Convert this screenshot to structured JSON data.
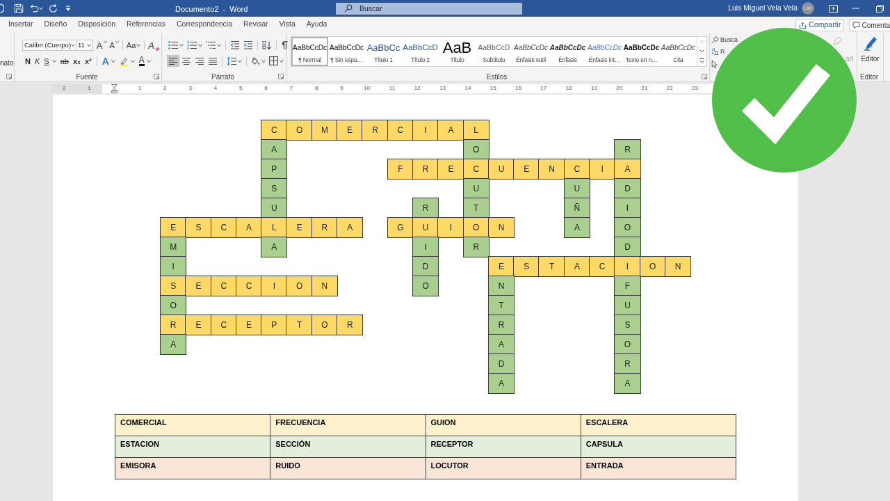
{
  "title_bar": {
    "title": "Documento2  -  Word",
    "search": {
      "placeholder": "Buscar"
    },
    "user": {
      "name": "Luis Miguel Vela Vela",
      "initials": "LM"
    }
  },
  "tabs": [
    {
      "label": "Insertar",
      "selected": false
    },
    {
      "label": "Diseño",
      "selected": false
    },
    {
      "label": "Disposición",
      "selected": false
    },
    {
      "label": "Referencias",
      "selected": false
    },
    {
      "label": "Correspondencia",
      "selected": false
    },
    {
      "label": "Revisar",
      "selected": false
    },
    {
      "label": "Vista",
      "selected": false
    },
    {
      "label": "Ayuda",
      "selected": false
    }
  ],
  "tab_actions": [
    {
      "kind": "share",
      "label": "Compartir"
    },
    {
      "kind": "comment",
      "label": "Comenta"
    }
  ],
  "ribbon": {
    "clipboard": {
      "partial_label": "nato"
    },
    "font": {
      "label": "Fuente",
      "family": "Calibri (Cuerpo)",
      "size": "11",
      "top_tools": [
        {
          "kind": "grow",
          "glyph": "A"
        },
        {
          "kind": "shrink",
          "glyph": "A"
        },
        {
          "kind": "case",
          "glyph": "Aa"
        },
        {
          "kind": "clear",
          "glyph": "A"
        }
      ],
      "bottom_tools": [
        {
          "kind": "bold",
          "glyph": "N"
        },
        {
          "kind": "italic",
          "glyph": "K"
        },
        {
          "kind": "underline",
          "glyph": "S"
        },
        {
          "kind": "strikethrough",
          "glyph": "ab"
        },
        {
          "kind": "subscript",
          "glyph": "x₂"
        },
        {
          "kind": "superscript",
          "glyph": "x²"
        },
        {
          "kind": "text_effects",
          "glyph": "A"
        },
        {
          "kind": "highlight"
        },
        {
          "kind": "font_color",
          "glyph": "A"
        }
      ]
    },
    "paragraph": {
      "label": "Párrafo",
      "alignments": [
        {
          "kind": "left",
          "selected": true
        },
        {
          "kind": "center",
          "selected": false
        },
        {
          "kind": "right",
          "selected": false
        },
        {
          "kind": "justify",
          "selected": false
        }
      ]
    },
    "styles": {
      "label": "Estilos",
      "items": [
        {
          "kind": "normal",
          "preview": "AaBbCcDc",
          "label": "¶ Normal",
          "selected": true
        },
        {
          "kind": "no_spacing",
          "preview": "AaBbCcDc",
          "label": "¶ Sin espa…",
          "selected": false
        },
        {
          "kind": "heading_1",
          "preview": "AaBbCc",
          "label": "Título 1",
          "selected": false
        },
        {
          "kind": "heading_2",
          "preview": "AaBbCcD",
          "label": "Título 2",
          "selected": false
        },
        {
          "kind": "title",
          "preview": "AaB",
          "label": "Título",
          "selected": false
        },
        {
          "kind": "subtitle",
          "preview": "AaBbCcD",
          "label": "Subtítulo",
          "selected": false
        },
        {
          "kind": "subtle_emphasis",
          "preview": "AaBbCcDc",
          "label": "Énfasis sutil",
          "selected": false
        },
        {
          "kind": "emphasis",
          "preview": "AaBbCcDc",
          "label": "Énfasis",
          "selected": false
        },
        {
          "kind": "intense_emphasis",
          "preview": "AaBbCcDc",
          "label": "Énfasis int…",
          "selected": false
        },
        {
          "kind": "strong",
          "preview": "AaBbCcDc",
          "label": "Texto en n…",
          "selected": false
        },
        {
          "kind": "quote",
          "preview": "AaBbCcDc",
          "label": "Cita",
          "selected": false
        }
      ]
    },
    "editing": {
      "tools": [
        {
          "kind": "find",
          "label": "Busca"
        },
        {
          "kind": "replace",
          "label": "R"
        },
        {
          "kind": "select"
        }
      ],
      "partial_label": "ad"
    },
    "editor": {
      "button": "Editor",
      "label": "Editor"
    }
  },
  "ruler": {
    "left_labels": [
      "2",
      "1"
    ],
    "labels": [
      "1",
      "2",
      "3",
      "4",
      "5",
      "6",
      "7",
      "8",
      "9",
      "10",
      "11",
      "12",
      "13",
      "14",
      "15",
      "16",
      "17",
      "18",
      "19",
      "20",
      "21",
      "22",
      "23"
    ]
  },
  "crossword": {
    "rows": [
      [
        null,
        null,
        null,
        null,
        {
          "letter": "C",
          "color": "#ffd966"
        },
        {
          "letter": "O",
          "color": "#ffd966"
        },
        {
          "letter": "M",
          "color": "#ffd966"
        },
        {
          "letter": "E",
          "color": "#ffd966"
        },
        {
          "letter": "R",
          "color": "#ffd966"
        },
        {
          "letter": "C",
          "color": "#ffd966"
        },
        {
          "letter": "I",
          "color": "#ffd966"
        },
        {
          "letter": "A",
          "color": "#ffd966"
        },
        {
          "letter": "L",
          "color": "#ffd966"
        }
      ],
      [
        null,
        null,
        null,
        null,
        {
          "letter": "A",
          "color": "#a9d08e"
        },
        null,
        null,
        null,
        null,
        null,
        null,
        null,
        {
          "letter": "O",
          "color": "#a9d08e"
        },
        null,
        null,
        null,
        null,
        null,
        {
          "letter": "R",
          "color": "#a9d08e"
        }
      ],
      [
        null,
        null,
        null,
        null,
        {
          "letter": "P",
          "color": "#a9d08e"
        },
        null,
        null,
        null,
        null,
        {
          "letter": "F",
          "color": "#ffd966"
        },
        {
          "letter": "R",
          "color": "#ffd966"
        },
        {
          "letter": "E",
          "color": "#ffd966"
        },
        {
          "letter": "C",
          "color": "#ffd966"
        },
        {
          "letter": "U",
          "color": "#ffd966"
        },
        {
          "letter": "E",
          "color": "#ffd966"
        },
        {
          "letter": "N",
          "color": "#ffd966"
        },
        {
          "letter": "C",
          "color": "#ffd966"
        },
        {
          "letter": "I",
          "color": "#ffd966"
        },
        {
          "letter": "A",
          "color": "#ffd966"
        }
      ],
      [
        null,
        null,
        null,
        null,
        {
          "letter": "S",
          "color": "#a9d08e"
        },
        null,
        null,
        null,
        null,
        null,
        null,
        null,
        {
          "letter": "U",
          "color": "#a9d08e"
        },
        null,
        null,
        null,
        {
          "letter": "U",
          "color": "#a9d08e"
        },
        null,
        {
          "letter": "D",
          "color": "#a9d08e"
        }
      ],
      [
        null,
        null,
        null,
        null,
        {
          "letter": "U",
          "color": "#a9d08e"
        },
        null,
        null,
        null,
        null,
        null,
        {
          "letter": "R",
          "color": "#a9d08e"
        },
        null,
        {
          "letter": "T",
          "color": "#a9d08e"
        },
        null,
        null,
        null,
        {
          "letter": "Ñ",
          "color": "#a9d08e"
        },
        null,
        {
          "letter": "I",
          "color": "#a9d08e"
        }
      ],
      [
        {
          "letter": "E",
          "color": "#ffd966"
        },
        {
          "letter": "S",
          "color": "#ffd966"
        },
        {
          "letter": "C",
          "color": "#ffd966"
        },
        {
          "letter": "A",
          "color": "#ffd966"
        },
        {
          "letter": "L",
          "color": "#ffd966"
        },
        {
          "letter": "E",
          "color": "#ffd966"
        },
        {
          "letter": "R",
          "color": "#ffd966"
        },
        {
          "letter": "A",
          "color": "#ffd966"
        },
        null,
        {
          "letter": "G",
          "color": "#ffd966"
        },
        {
          "letter": "U",
          "color": "#ffd966"
        },
        {
          "letter": "I",
          "color": "#ffd966"
        },
        {
          "letter": "O",
          "color": "#ffd966"
        },
        {
          "letter": "N",
          "color": "#ffd966"
        },
        null,
        null,
        {
          "letter": "A",
          "color": "#a9d08e"
        },
        null,
        {
          "letter": "O",
          "color": "#a9d08e"
        }
      ],
      [
        {
          "letter": "M",
          "color": "#a9d08e"
        },
        null,
        null,
        null,
        {
          "letter": "A",
          "color": "#a9d08e"
        },
        null,
        null,
        null,
        null,
        null,
        {
          "letter": "I",
          "color": "#a9d08e"
        },
        null,
        {
          "letter": "R",
          "color": "#a9d08e"
        },
        null,
        null,
        null,
        null,
        null,
        {
          "letter": "D",
          "color": "#a9d08e"
        }
      ],
      [
        {
          "letter": "I",
          "color": "#a9d08e"
        },
        null,
        null,
        null,
        null,
        null,
        null,
        null,
        null,
        null,
        {
          "letter": "D",
          "color": "#a9d08e"
        },
        null,
        null,
        {
          "letter": "E",
          "color": "#ffd966"
        },
        {
          "letter": "S",
          "color": "#ffd966"
        },
        {
          "letter": "T",
          "color": "#ffd966"
        },
        {
          "letter": "A",
          "color": "#ffd966"
        },
        {
          "letter": "C",
          "color": "#ffd966"
        },
        {
          "letter": "I",
          "color": "#ffd966"
        },
        {
          "letter": "O",
          "color": "#ffd966"
        },
        {
          "letter": "N",
          "color": "#ffd966"
        }
      ],
      [
        {
          "letter": "S",
          "color": "#ffd966"
        },
        {
          "letter": "E",
          "color": "#ffd966"
        },
        {
          "letter": "C",
          "color": "#ffd966"
        },
        {
          "letter": "C",
          "color": "#ffd966"
        },
        {
          "letter": "I",
          "color": "#ffd966"
        },
        {
          "letter": "O",
          "color": "#ffd966"
        },
        {
          "letter": "N",
          "color": "#ffd966"
        },
        null,
        null,
        null,
        {
          "letter": "O",
          "color": "#a9d08e"
        },
        null,
        null,
        {
          "letter": "N",
          "color": "#a9d08e"
        },
        null,
        null,
        null,
        null,
        {
          "letter": "F",
          "color": "#a9d08e"
        }
      ],
      [
        {
          "letter": "O",
          "color": "#a9d08e"
        },
        null,
        null,
        null,
        null,
        null,
        null,
        null,
        null,
        null,
        null,
        null,
        null,
        {
          "letter": "T",
          "color": "#a9d08e"
        },
        null,
        null,
        null,
        null,
        {
          "letter": "U",
          "color": "#a9d08e"
        }
      ],
      [
        {
          "letter": "R",
          "color": "#ffd966"
        },
        {
          "letter": "E",
          "color": "#ffd966"
        },
        {
          "letter": "C",
          "color": "#ffd966"
        },
        {
          "letter": "E",
          "color": "#ffd966"
        },
        {
          "letter": "P",
          "color": "#ffd966"
        },
        {
          "letter": "T",
          "color": "#ffd966"
        },
        {
          "letter": "O",
          "color": "#ffd966"
        },
        {
          "letter": "R",
          "color": "#ffd966"
        },
        null,
        null,
        null,
        null,
        null,
        {
          "letter": "R",
          "color": "#a9d08e"
        },
        null,
        null,
        null,
        null,
        {
          "letter": "S",
          "color": "#a9d08e"
        }
      ],
      [
        {
          "letter": "A",
          "color": "#a9d08e"
        },
        null,
        null,
        null,
        null,
        null,
        null,
        null,
        null,
        null,
        null,
        null,
        null,
        {
          "letter": "A",
          "color": "#a9d08e"
        },
        null,
        null,
        null,
        null,
        {
          "letter": "O",
          "color": "#a9d08e"
        }
      ],
      [
        null,
        null,
        null,
        null,
        null,
        null,
        null,
        null,
        null,
        null,
        null,
        null,
        null,
        {
          "letter": "D",
          "color": "#a9d08e"
        },
        null,
        null,
        null,
        null,
        {
          "letter": "R",
          "color": "#a9d08e"
        }
      ],
      [
        null,
        null,
        null,
        null,
        null,
        null,
        null,
        null,
        null,
        null,
        null,
        null,
        null,
        {
          "letter": "A",
          "color": "#a9d08e"
        },
        null,
        null,
        null,
        null,
        {
          "letter": "A",
          "color": "#a9d08e"
        }
      ]
    ]
  },
  "word_bank": {
    "rows": [
      {
        "color": "#fff2cc",
        "cells": [
          "COMERCIAL",
          "FRECUENCIA",
          "GUION",
          "ESCALERA"
        ]
      },
      {
        "color": "#e2efda",
        "cells": [
          "ESTACION",
          "SECCIÓN",
          "RECEPTOR",
          "CAPSULA"
        ]
      },
      {
        "color": "#fbe5d6",
        "cells": [
          "EMISORA",
          "RUIDO",
          "LOCUTOR",
          "ENTRADA"
        ]
      }
    ]
  }
}
